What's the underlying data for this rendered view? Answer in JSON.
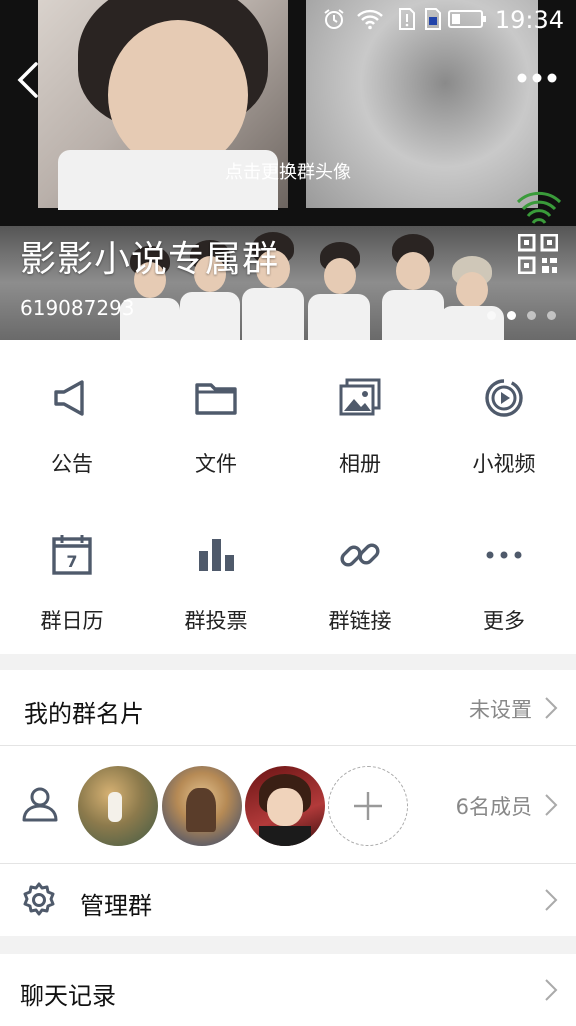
{
  "status_bar": {
    "time": "19:34"
  },
  "header": {
    "avatar_hint": "点击更换群头像",
    "group_name": "影影小说专属群",
    "group_id": "619087293",
    "carousel_count": 4,
    "carousel_active_index": 1
  },
  "features": [
    {
      "label": "公告",
      "icon": "megaphone-icon"
    },
    {
      "label": "文件",
      "icon": "folder-icon"
    },
    {
      "label": "相册",
      "icon": "photo-album-icon"
    },
    {
      "label": "小视频",
      "icon": "video-icon"
    },
    {
      "label": "群日历",
      "icon": "calendar-icon"
    },
    {
      "label": "群投票",
      "icon": "vote-chart-icon"
    },
    {
      "label": "群链接",
      "icon": "link-icon"
    },
    {
      "label": "更多",
      "icon": "more-icon"
    }
  ],
  "card_row": {
    "title": "我的群名片",
    "value": "未设置"
  },
  "members_row": {
    "count_label": "6名成员"
  },
  "manage_row": {
    "title": "管理群"
  },
  "history_row": {
    "title": "聊天记录"
  },
  "colors": {
    "icon": "#4f5a6b",
    "divider": "#e4e4e4",
    "background": "#f2f2f2"
  }
}
